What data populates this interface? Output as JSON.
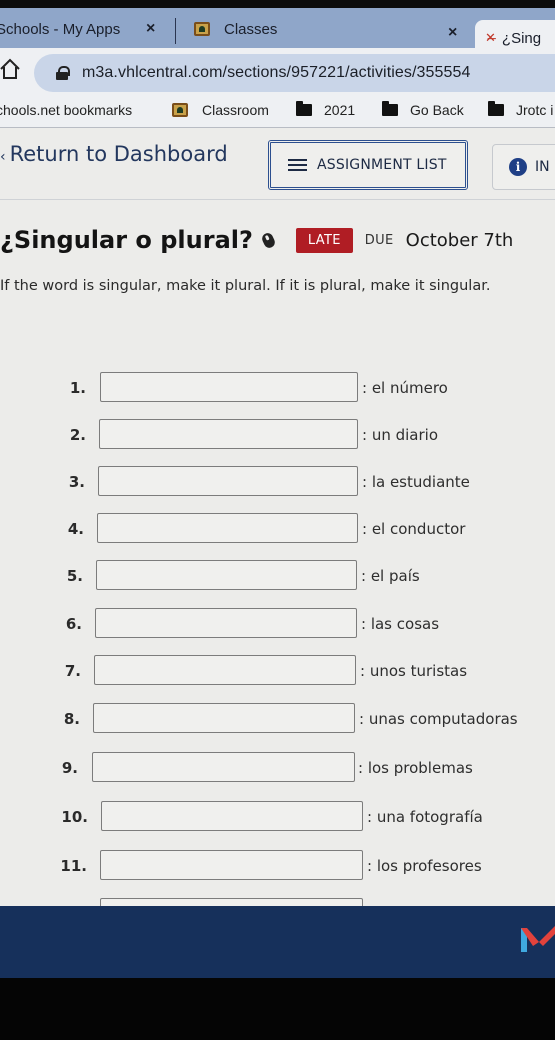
{
  "browser": {
    "tabs": [
      {
        "title": "Schools - My Apps",
        "close": "×"
      },
      {
        "title": "Classes",
        "icon": "google-classroom-icon",
        "close": "×"
      },
      {
        "title": "¿Sing",
        "icon": "vhl-icon",
        "active": true
      }
    ],
    "url": "m3a.vhlcentral.com/sections/957221/activities/355554",
    "bookmarks": [
      {
        "label": "chools.net bookmarks"
      },
      {
        "label": "Classroom",
        "icon": "google-classroom-icon"
      },
      {
        "label": "2021",
        "icon": "folder-icon"
      },
      {
        "label": "Go Back",
        "icon": "folder-icon"
      },
      {
        "label": "Jrotc i",
        "icon": "folder-icon"
      }
    ]
  },
  "nav": {
    "return_label": "Return to Dashboard",
    "assignment_list_label": "ASSIGNMENT LIST",
    "info_label": "IN"
  },
  "activity": {
    "title": "¿Singular o plural?",
    "status_badge": "LATE",
    "due_label": "DUE",
    "due_date": "October 7th",
    "instructions": "If the word is singular, make it plural. If it is plural, make it singular."
  },
  "items": [
    {
      "number": "1.",
      "value": "",
      "prompt": ": el número"
    },
    {
      "number": "2.",
      "value": "",
      "prompt": ": un diario"
    },
    {
      "number": "3.",
      "value": "",
      "prompt": ": la estudiante"
    },
    {
      "number": "4.",
      "value": "",
      "prompt": ": el conductor"
    },
    {
      "number": "5.",
      "value": "",
      "prompt": ": el país"
    },
    {
      "number": "6.",
      "value": "",
      "prompt": ": las cosas"
    },
    {
      "number": "7.",
      "value": "",
      "prompt": ": unos turistas"
    },
    {
      "number": "8.",
      "value": "",
      "prompt": ": unas computadoras"
    },
    {
      "number": "9.",
      "value": "",
      "prompt": ": los problemas"
    },
    {
      "number": "10.",
      "value": "",
      "prompt": ": una fotografía"
    },
    {
      "number": "11.",
      "value": "",
      "prompt": ": los profesores"
    }
  ],
  "colors": {
    "brand_navy": "#16305b",
    "late_red": "#b01d24",
    "link_blue": "#23375e"
  }
}
